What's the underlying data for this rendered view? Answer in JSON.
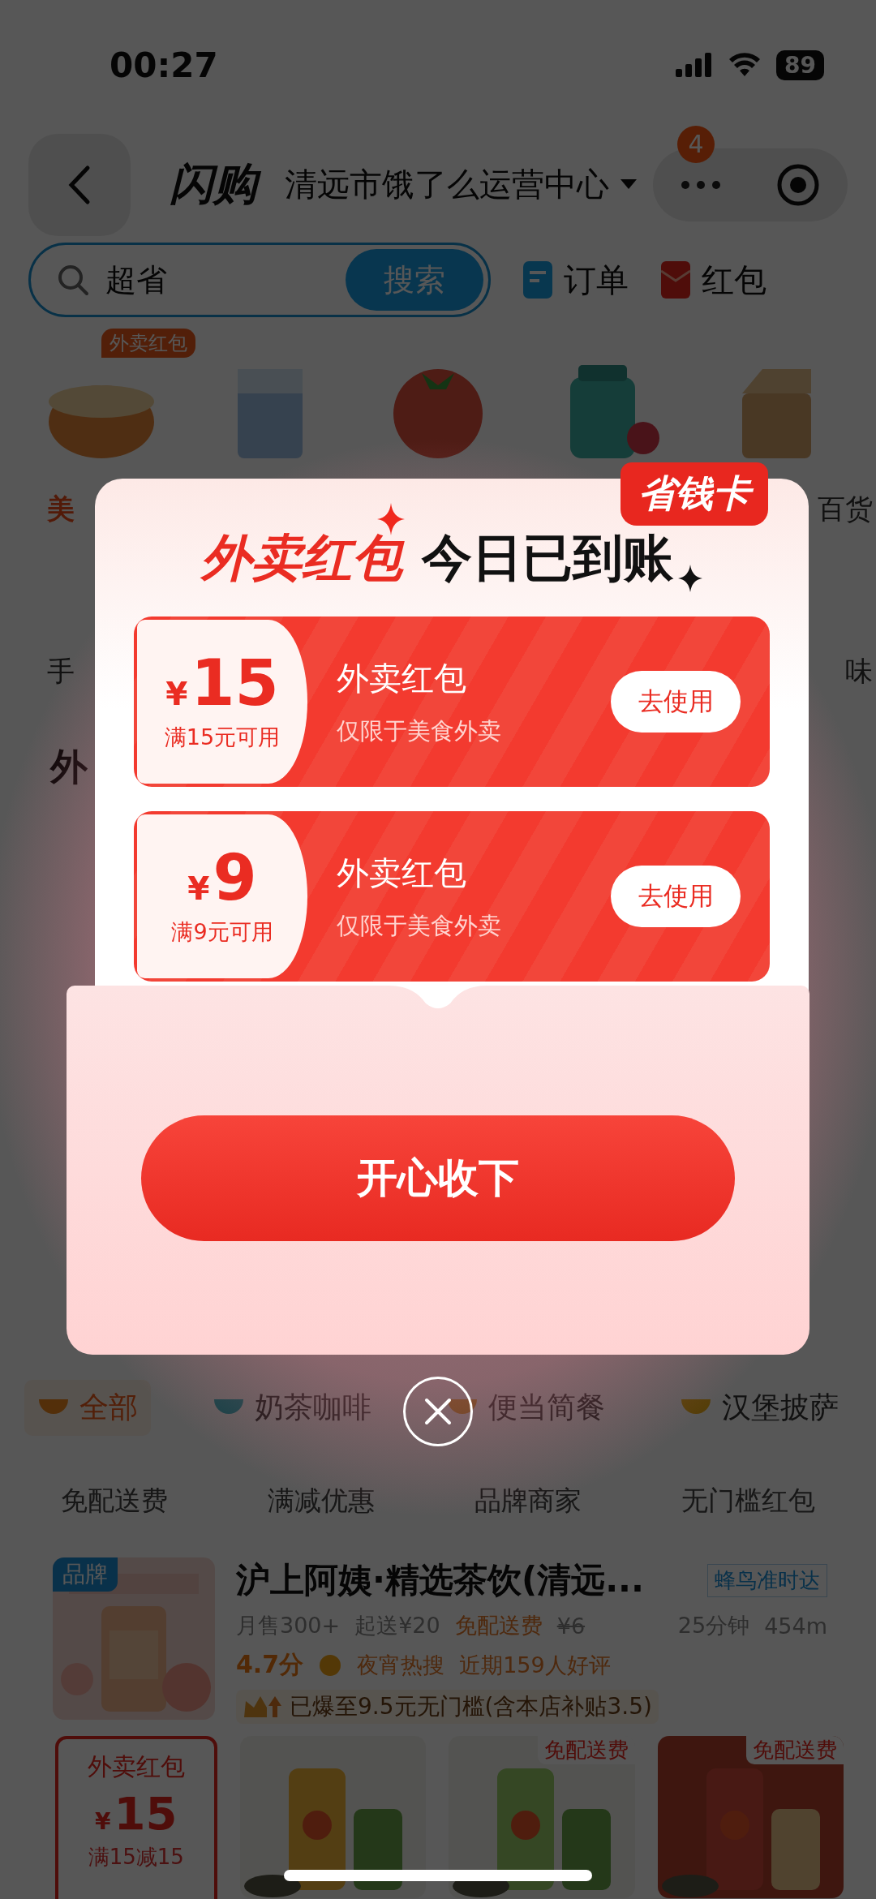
{
  "status_bar": {
    "time": "00:27",
    "battery": "89"
  },
  "header": {
    "logo": "闪购",
    "location": "清远市饿了么运营中心",
    "badge": "4"
  },
  "search": {
    "value": "超省",
    "button": "搜索"
  },
  "shortcuts": [
    {
      "kind": "order",
      "label": "订单"
    },
    {
      "kind": "packet",
      "label": "红包"
    }
  ],
  "categories": [
    {
      "label": "美",
      "tag": "外卖红包",
      "selected": true
    },
    {
      "label": "百货",
      "selected": false
    }
  ],
  "categories_row_2": [
    "手",
    "味"
  ],
  "section_title": "外",
  "popup": {
    "badge": "省钱卡",
    "title_highlight": "外卖红包",
    "title": "今日已到账",
    "coupons": [
      {
        "currency": "¥",
        "amount": "15",
        "condition": "满15元可用",
        "name": "外卖红包",
        "scope": "仅限于美食外卖",
        "button": "去使用"
      },
      {
        "currency": "¥",
        "amount": "9",
        "condition": "满9元可用",
        "name": "外卖红包",
        "scope": "仅限于美食外卖",
        "button": "去使用"
      }
    ],
    "confirm": "开心收下"
  },
  "food_tabs": [
    {
      "label": "全部",
      "selected": true
    },
    {
      "label": "奶茶咖啡",
      "selected": false
    },
    {
      "label": "便当简餐",
      "selected": false
    },
    {
      "label": "汉堡披萨",
      "selected": false
    }
  ],
  "filters": [
    "免配送费",
    "满减优惠",
    "品牌商家",
    "无门槛红包"
  ],
  "store": {
    "tag": "品牌",
    "name": "沪上阿姨·精选茶饮(清远...",
    "delivery": "蜂鸟准时达",
    "sales": "月售300+",
    "min_order": "起送¥20",
    "free_delivery": "免配送费",
    "old_fee": "¥6",
    "time": "25分钟",
    "distance": "454m",
    "rating": "4.7分",
    "hot": "夜宵热搜",
    "reviews": "近期159人好评",
    "promo": "已爆至9.5元无门槛(含本店补贴3.5)"
  },
  "bottom": {
    "coupon": {
      "title": "外卖红包",
      "currency": "¥",
      "amount": "15",
      "condition": "满15减15"
    },
    "products": [
      {
        "kind": "picture"
      },
      {
        "kind": "picture",
        "tag": "免配送费"
      },
      {
        "kind": "picture",
        "tag": "免配送费"
      }
    ]
  }
}
